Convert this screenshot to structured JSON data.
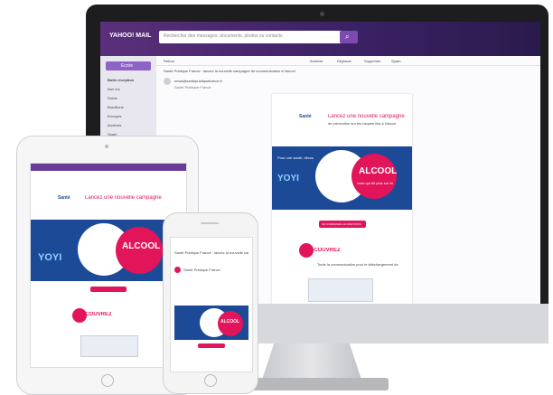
{
  "mail": {
    "search_placeholder": "Rechercher des messages, documents, photos ou contacts",
    "brand": "YAHOO! MAIL",
    "compose_label": "Écrire",
    "folders": [
      "Boîte réception",
      "Non lus",
      "Suivis",
      "Brouillons",
      "Envoyés",
      "Archivés",
      "Spam",
      "Corbeille",
      "Plus"
    ],
    "toolbar": [
      "Retour",
      "Archiver",
      "Déplacer",
      "Supprimer",
      "Spam"
    ],
    "subject": "Santé Publique France : lancez la nouvelle campagne de communication à l'alcool",
    "sender": "Santé Publique France",
    "sender_email": "news@santepubliquefrance.fr"
  },
  "newsletter": {
    "brand_line1": "Santé",
    "brand_line2": "publique",
    "brand_line3": "France",
    "headline": "Lancez une nouvelle campagne",
    "subhead": "de prévention sur les risques liés à l'alcool",
    "poster_word": "ALCOOL",
    "poster_sub": "mais qui dit plus sur toi ?",
    "side_text": "Pour une santé, découvrez",
    "logo_word": "YOYI",
    "cta_label": "JE COMMANDE LE DISPOSITIF",
    "discover_label": "DÉCOUVREZ",
    "discover_text": "Toute la communication pour le téléchargement de votre campagne"
  },
  "phone": {
    "subject": "Santé Publique France : lancez la nouvelle campagne",
    "sender": "Santé Publique France"
  },
  "colors": {
    "header": "#4a2a6e",
    "pink": "#e2145a",
    "blue": "#1c4a97"
  }
}
